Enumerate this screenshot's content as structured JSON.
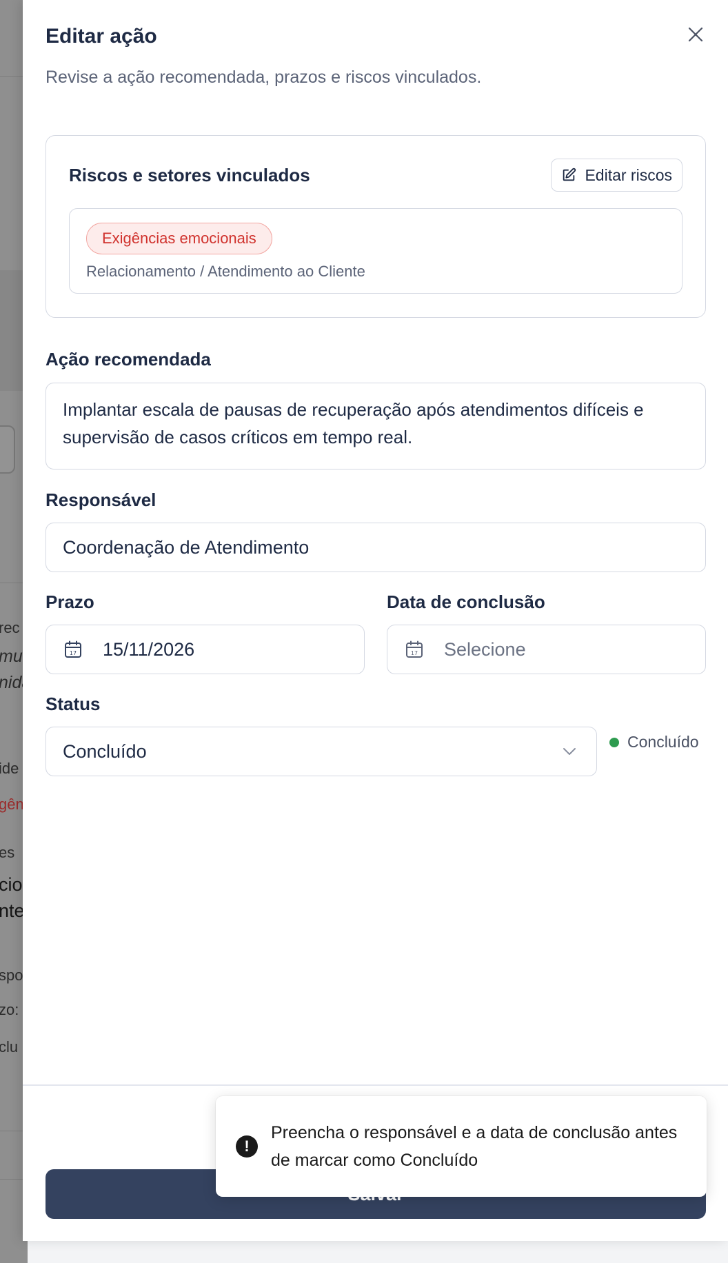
{
  "background": {
    "snippets": [
      "rec",
      "mur",
      "nida",
      "ide",
      "gên",
      "es",
      "cio",
      "nte",
      "spor",
      "zo:",
      "clu"
    ]
  },
  "drawer": {
    "title": "Editar ação",
    "subtitle": "Revise a ação recomendada, prazos e riscos vinculados.",
    "close_icon": "close-icon"
  },
  "risks": {
    "title": "Riscos e setores vinculados",
    "edit_button": "Editar riscos",
    "edit_icon": "edit-icon",
    "items": [
      {
        "tag": "Exigências emocionais",
        "sector": "Relacionamento / Atendimento ao Cliente"
      }
    ]
  },
  "form": {
    "action_label": "Ação recomendada",
    "action_value": "Implantar escala de pausas de recuperação após atendimentos difíceis e supervisão de casos críticos em tempo real.",
    "owner_label": "Responsável",
    "owner_value": "Coordenação de Atendimento",
    "deadline_label": "Prazo",
    "deadline_value": "15/11/2026",
    "completion_label": "Data de conclusão",
    "completion_placeholder": "Selecione",
    "status_label": "Status",
    "status_value": "Concluído",
    "status_indicator": "Concluído",
    "status_color": "#2e9b4f"
  },
  "footer": {
    "save_label": "Salvar"
  },
  "toast": {
    "message": "Preencha o responsável e a data de conclusão antes de marcar como Concluído",
    "icon": "alert-icon"
  },
  "colors": {
    "primary": "#34425f",
    "danger": "#d0322d",
    "success": "#2e9b4f"
  }
}
